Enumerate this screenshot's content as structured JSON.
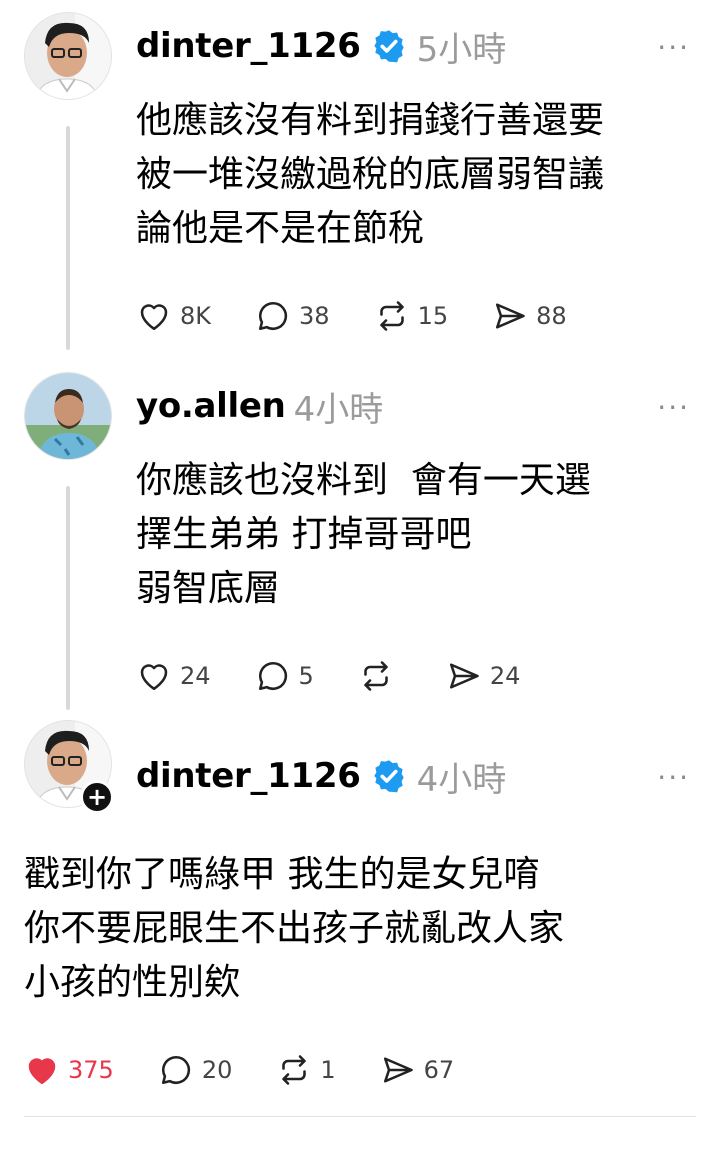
{
  "posts": [
    {
      "username": "dinter_1126",
      "verified": true,
      "time": "5小時",
      "lines": [
        "他應該沒有料到捐錢行善還要",
        "被一堆沒繳過稅的底層弱智議",
        "論他是不是在節稅"
      ],
      "likes": "8K",
      "replies": "38",
      "reposts": "15",
      "shares": "88",
      "liked": false
    },
    {
      "username": "yo.allen",
      "verified": false,
      "time": "4小時",
      "lines": [
        "你應該也沒料到  會有一天選",
        "擇生弟弟 打掉哥哥吧",
        "弱智底層"
      ],
      "likes": "24",
      "replies": "5",
      "reposts": "",
      "shares": "24",
      "liked": false
    },
    {
      "username": "dinter_1126",
      "verified": true,
      "time": "4小時",
      "lines": [
        "戳到你了嗎綠甲 我生的是女兒唷",
        "你不要屁眼生不出孩子就亂改人家",
        "小孩的性別欸"
      ],
      "likes": "375",
      "replies": "20",
      "reposts": "1",
      "shares": "67",
      "liked": true
    }
  ],
  "icons": {
    "more": "more-horizontal-icon",
    "verified": "verified-badge-icon",
    "like": "heart-icon",
    "reply": "comment-bubble-icon",
    "repost": "repost-arrows-icon",
    "share": "send-arrow-icon",
    "follow": "plus-icon"
  },
  "colors": {
    "verified": "#1d9bf0",
    "liked": "#e8364b",
    "muted": "#9b9b9b",
    "thread_line": "#d9d9d9"
  },
  "follow_badge": "+",
  "more_glyph": "···"
}
